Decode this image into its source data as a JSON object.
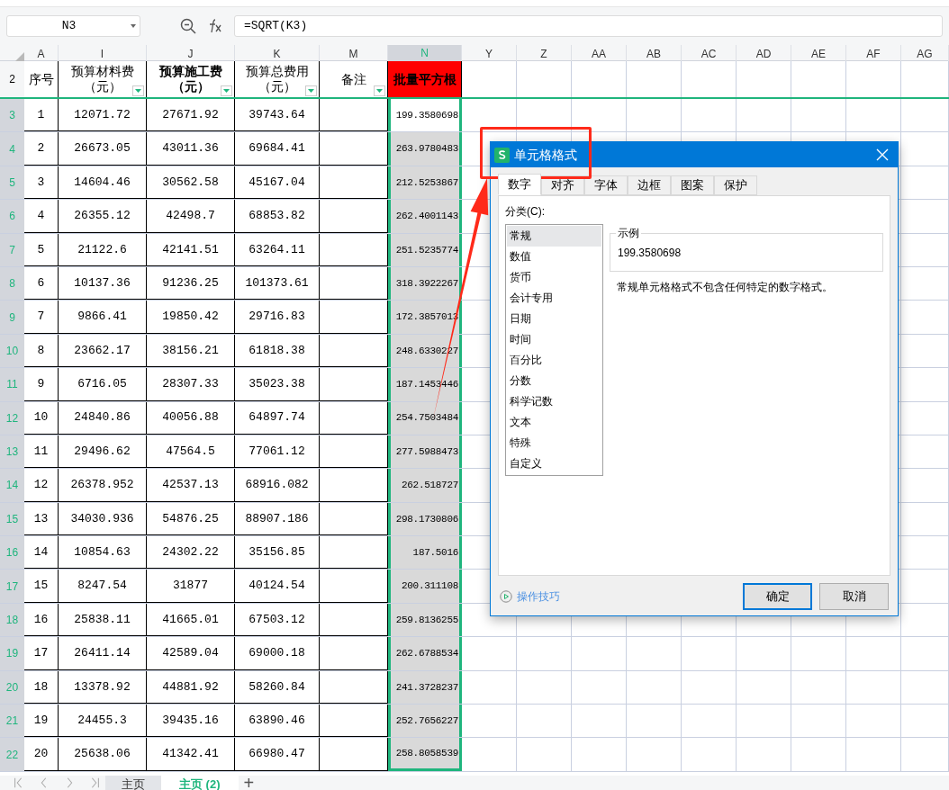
{
  "formula_bar": {
    "name_box": "N3",
    "formula": "=SQRT(K3)"
  },
  "columns": [
    {
      "label": "A",
      "selected": false
    },
    {
      "label": "I",
      "selected": false
    },
    {
      "label": "J",
      "selected": false
    },
    {
      "label": "K",
      "selected": false
    },
    {
      "label": "M",
      "selected": false
    },
    {
      "label": "N",
      "selected": true
    },
    {
      "label": "Y",
      "selected": false
    },
    {
      "label": "Z",
      "selected": false
    },
    {
      "label": "AA",
      "selected": false
    },
    {
      "label": "AB",
      "selected": false
    },
    {
      "label": "AC",
      "selected": false
    },
    {
      "label": "AD",
      "selected": false
    },
    {
      "label": "AE",
      "selected": false
    },
    {
      "label": "AF",
      "selected": false
    },
    {
      "label": "AG",
      "selected": false
    }
  ],
  "header_row": {
    "number": "2",
    "cells": [
      {
        "text": "序号",
        "bold": false,
        "filter": false,
        "highlight": false
      },
      {
        "text": "预算材料费（元）",
        "bold": false,
        "filter": true,
        "highlight": false
      },
      {
        "text": "预算施工费（元）",
        "bold": true,
        "filter": true,
        "highlight": false
      },
      {
        "text": "预算总费用（元）",
        "bold": false,
        "filter": true,
        "highlight": false
      },
      {
        "text": "备注",
        "bold": false,
        "filter": true,
        "highlight": false
      },
      {
        "text": "批量平方根",
        "bold": true,
        "filter": false,
        "highlight": true
      }
    ]
  },
  "rows": [
    {
      "number": "3",
      "selected": true,
      "a": "1",
      "i": "12071.72",
      "j": "27671.92",
      "k": "39743.64",
      "n": "199.3580698",
      "active": true
    },
    {
      "number": "4",
      "selected": true,
      "a": "2",
      "i": "26673.05",
      "j": "43011.36",
      "k": "69684.41",
      "n": "263.9780483",
      "active": false
    },
    {
      "number": "5",
      "selected": true,
      "a": "3",
      "i": "14604.46",
      "j": "30562.58",
      "k": "45167.04",
      "n": "212.5253867",
      "active": false
    },
    {
      "number": "6",
      "selected": true,
      "a": "4",
      "i": "26355.12",
      "j": "42498.7",
      "k": "68853.82",
      "n": "262.4001143",
      "active": false
    },
    {
      "number": "7",
      "selected": true,
      "a": "5",
      "i": "21122.6",
      "j": "42141.51",
      "k": "63264.11",
      "n": "251.5235774",
      "active": false
    },
    {
      "number": "8",
      "selected": true,
      "a": "6",
      "i": "10137.36",
      "j": "91236.25",
      "k": "101373.61",
      "n": "318.3922267",
      "active": false
    },
    {
      "number": "9",
      "selected": true,
      "a": "7",
      "i": "9866.41",
      "j": "19850.42",
      "k": "29716.83",
      "n": "172.3857013",
      "active": false
    },
    {
      "number": "10",
      "selected": true,
      "a": "8",
      "i": "23662.17",
      "j": "38156.21",
      "k": "61818.38",
      "n": "248.6330227",
      "active": false
    },
    {
      "number": "11",
      "selected": true,
      "a": "9",
      "i": "6716.05",
      "j": "28307.33",
      "k": "35023.38",
      "n": "187.1453446",
      "active": false
    },
    {
      "number": "12",
      "selected": true,
      "a": "10",
      "i": "24840.86",
      "j": "40056.88",
      "k": "64897.74",
      "n": "254.7503484",
      "active": false
    },
    {
      "number": "13",
      "selected": true,
      "a": "11",
      "i": "29496.62",
      "j": "47564.5",
      "k": "77061.12",
      "n": "277.5988473",
      "active": false
    },
    {
      "number": "14",
      "selected": true,
      "a": "12",
      "i": "26378.952",
      "j": "42537.13",
      "k": "68916.082",
      "n": "262.518727",
      "active": false
    },
    {
      "number": "15",
      "selected": true,
      "a": "13",
      "i": "34030.936",
      "j": "54876.25",
      "k": "88907.186",
      "n": "298.1730806",
      "active": false
    },
    {
      "number": "16",
      "selected": true,
      "a": "14",
      "i": "10854.63",
      "j": "24302.22",
      "k": "35156.85",
      "n": "187.5016",
      "active": false
    },
    {
      "number": "17",
      "selected": true,
      "a": "15",
      "i": "8247.54",
      "j": "31877",
      "k": "40124.54",
      "n": "200.311108",
      "active": false
    },
    {
      "number": "18",
      "selected": true,
      "a": "16",
      "i": "25838.11",
      "j": "41665.01",
      "k": "67503.12",
      "n": "259.8136255",
      "active": false
    },
    {
      "number": "19",
      "selected": true,
      "a": "17",
      "i": "26411.14",
      "j": "42589.04",
      "k": "69000.18",
      "n": "262.6788534",
      "active": false
    },
    {
      "number": "20",
      "selected": true,
      "a": "18",
      "i": "13378.92",
      "j": "44881.92",
      "k": "58260.84",
      "n": "241.3728237",
      "active": false
    },
    {
      "number": "21",
      "selected": true,
      "a": "19",
      "i": "24455.3",
      "j": "39435.16",
      "k": "63890.46",
      "n": "252.7656227",
      "active": false
    },
    {
      "number": "22",
      "selected": true,
      "a": "20",
      "i": "25638.06",
      "j": "41342.41",
      "k": "66980.47",
      "n": "258.8058539",
      "active": false
    }
  ],
  "sheet_tabs": [
    {
      "label": "主页",
      "selected": false
    },
    {
      "label": "主页 (2)",
      "selected": true
    }
  ],
  "add_sheet": "+",
  "dialog": {
    "title": "单元格格式",
    "tabs": [
      {
        "label": "数字",
        "selected": true
      },
      {
        "label": "对齐",
        "selected": false
      },
      {
        "label": "字体",
        "selected": false
      },
      {
        "label": "边框",
        "selected": false
      },
      {
        "label": "图案",
        "selected": false
      },
      {
        "label": "保护",
        "selected": false
      }
    ],
    "category_label": "分类(C):",
    "categories": [
      {
        "label": "常规",
        "selected": true
      },
      {
        "label": "数值",
        "selected": false
      },
      {
        "label": "货币",
        "selected": false
      },
      {
        "label": "会计专用",
        "selected": false
      },
      {
        "label": "日期",
        "selected": false
      },
      {
        "label": "时间",
        "selected": false
      },
      {
        "label": "百分比",
        "selected": false
      },
      {
        "label": "分数",
        "selected": false
      },
      {
        "label": "科学记数",
        "selected": false
      },
      {
        "label": "文本",
        "selected": false
      },
      {
        "label": "特殊",
        "selected": false
      },
      {
        "label": "自定义",
        "selected": false
      }
    ],
    "sample_label": "示例",
    "sample_value": "199.3580698",
    "description": "常规单元格格式不包含任何特定的数字格式。",
    "tips_link": "操作技巧",
    "buttons": [
      {
        "label": "确定",
        "kind": "primary"
      },
      {
        "label": "取消",
        "kind": "default"
      }
    ]
  }
}
